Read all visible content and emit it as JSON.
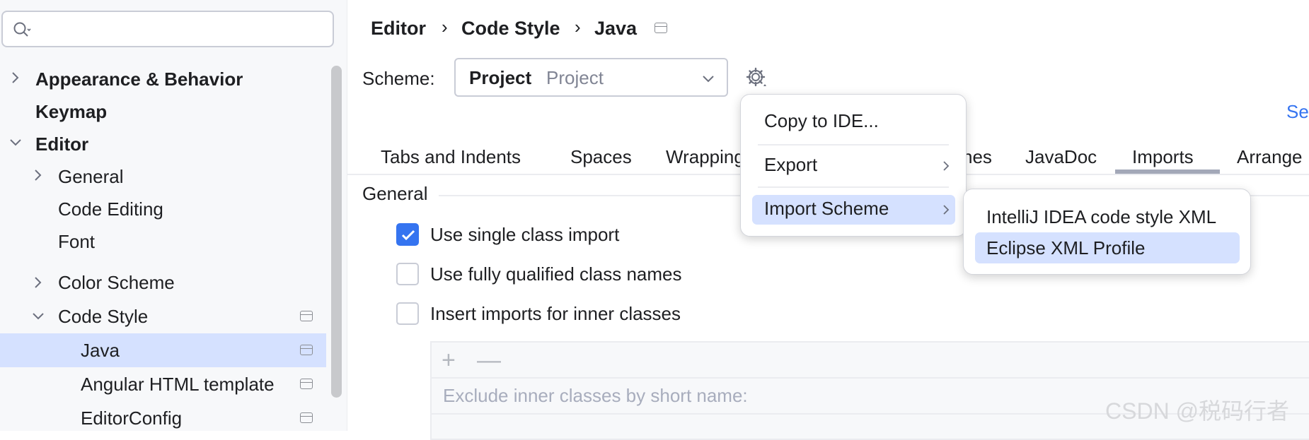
{
  "search": {
    "placeholder": ""
  },
  "sidebar": {
    "items": [
      {
        "label": "Appearance & Behavior"
      },
      {
        "label": "Keymap"
      },
      {
        "label": "Editor"
      },
      {
        "label": "General"
      },
      {
        "label": "Code Editing"
      },
      {
        "label": "Font"
      },
      {
        "label": "Color Scheme"
      },
      {
        "label": "Code Style"
      },
      {
        "label": "Java"
      },
      {
        "label": "Angular HTML template"
      },
      {
        "label": "EditorConfig"
      }
    ]
  },
  "breadcrumb": {
    "items": [
      "Editor",
      "Code Style",
      "Java"
    ],
    "separator": "›"
  },
  "scheme": {
    "label": "Scheme:",
    "value_bold": "Project",
    "value_grey": "Project"
  },
  "link_partial": "Se",
  "tabs": [
    {
      "label": "Tabs and Indents"
    },
    {
      "label": "Spaces"
    },
    {
      "label": "Wrapping"
    },
    {
      "label": "nes"
    },
    {
      "label": "JavaDoc"
    },
    {
      "label": "Imports"
    },
    {
      "label": "Arrange"
    }
  ],
  "active_tab": "Imports",
  "general": {
    "title": "General",
    "options": [
      {
        "label": "Use single class import",
        "checked": true
      },
      {
        "label": "Use fully qualified class names",
        "checked": false
      },
      {
        "label": "Insert imports for inner classes",
        "checked": false
      }
    ]
  },
  "exclude": {
    "placeholder": "Exclude inner classes by short name:",
    "add": "+",
    "remove": "—"
  },
  "gear_menu": {
    "items": [
      "Copy to IDE...",
      "Export",
      "Import Scheme"
    ]
  },
  "import_submenu": {
    "items": [
      "IntelliJ IDEA code style XML",
      "Eclipse XML Profile"
    ]
  },
  "watermark": "CSDN @税码行者",
  "colors": {
    "accent": "#3574f0",
    "selection": "#d5e1ff"
  }
}
